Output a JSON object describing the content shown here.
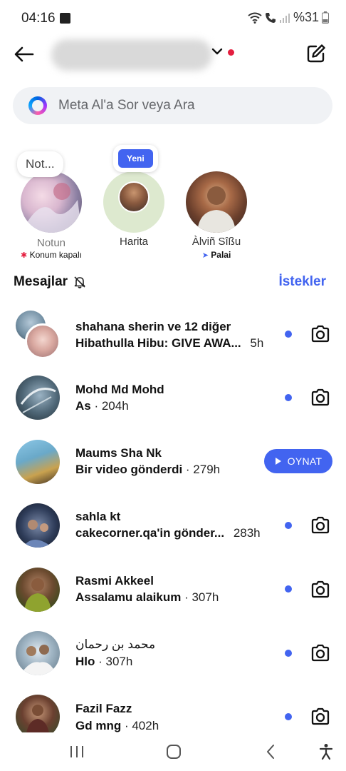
{
  "status": {
    "time": "04:16",
    "battery": "%31"
  },
  "header": {
    "account_name_hidden": true
  },
  "search": {
    "placeholder": "Meta Al'a Sor veya Ara"
  },
  "notes": [
    {
      "bubble": "Not...",
      "name": "Notun",
      "sub": "Konum kapalı",
      "sub_icon": "pin-icon"
    },
    {
      "badge": "Yeni",
      "name": "Harita",
      "sub": ""
    },
    {
      "name": "Àlviñ Sîßu",
      "sub": "Palai",
      "sub_icon": "location-arrow-icon"
    }
  ],
  "section": {
    "title": "Mesajlar",
    "requests": "İstekler"
  },
  "conversations": [
    {
      "name": "shahana sherin ve 12 diğer",
      "preview": "Hibathulla Hibu: GIVE AWA...",
      "time": "5h",
      "unread": true,
      "action": "camera"
    },
    {
      "name": "Mohd Md Mohd",
      "preview": "As",
      "time": "· 204h",
      "unread": true,
      "action": "camera"
    },
    {
      "name": "Maums Sha Nk",
      "preview": "Bir video gönderdi",
      "time": "· 279h",
      "unread": false,
      "action": "play",
      "action_label": "OYNAT"
    },
    {
      "name": "sahla kt",
      "preview": "cakecorner.qa'in gönder...",
      "time": "283h",
      "unread": true,
      "action": "camera"
    },
    {
      "name": "Rasmi Akkeel",
      "preview": "Assalamu alaikum",
      "time": "· 307h",
      "unread": true,
      "action": "camera"
    },
    {
      "name": "محمد بن رحمان",
      "preview": "Hlo",
      "time": "· 307h",
      "unread": true,
      "action": "camera"
    },
    {
      "name": "Fazil Fazz",
      "preview": "Gd mng",
      "time": "· 402h",
      "unread": true,
      "action": "camera"
    }
  ],
  "colors": {
    "accent": "#4264f0",
    "red_dot": "#e41e3f",
    "search_bg": "#f0f2f5"
  }
}
